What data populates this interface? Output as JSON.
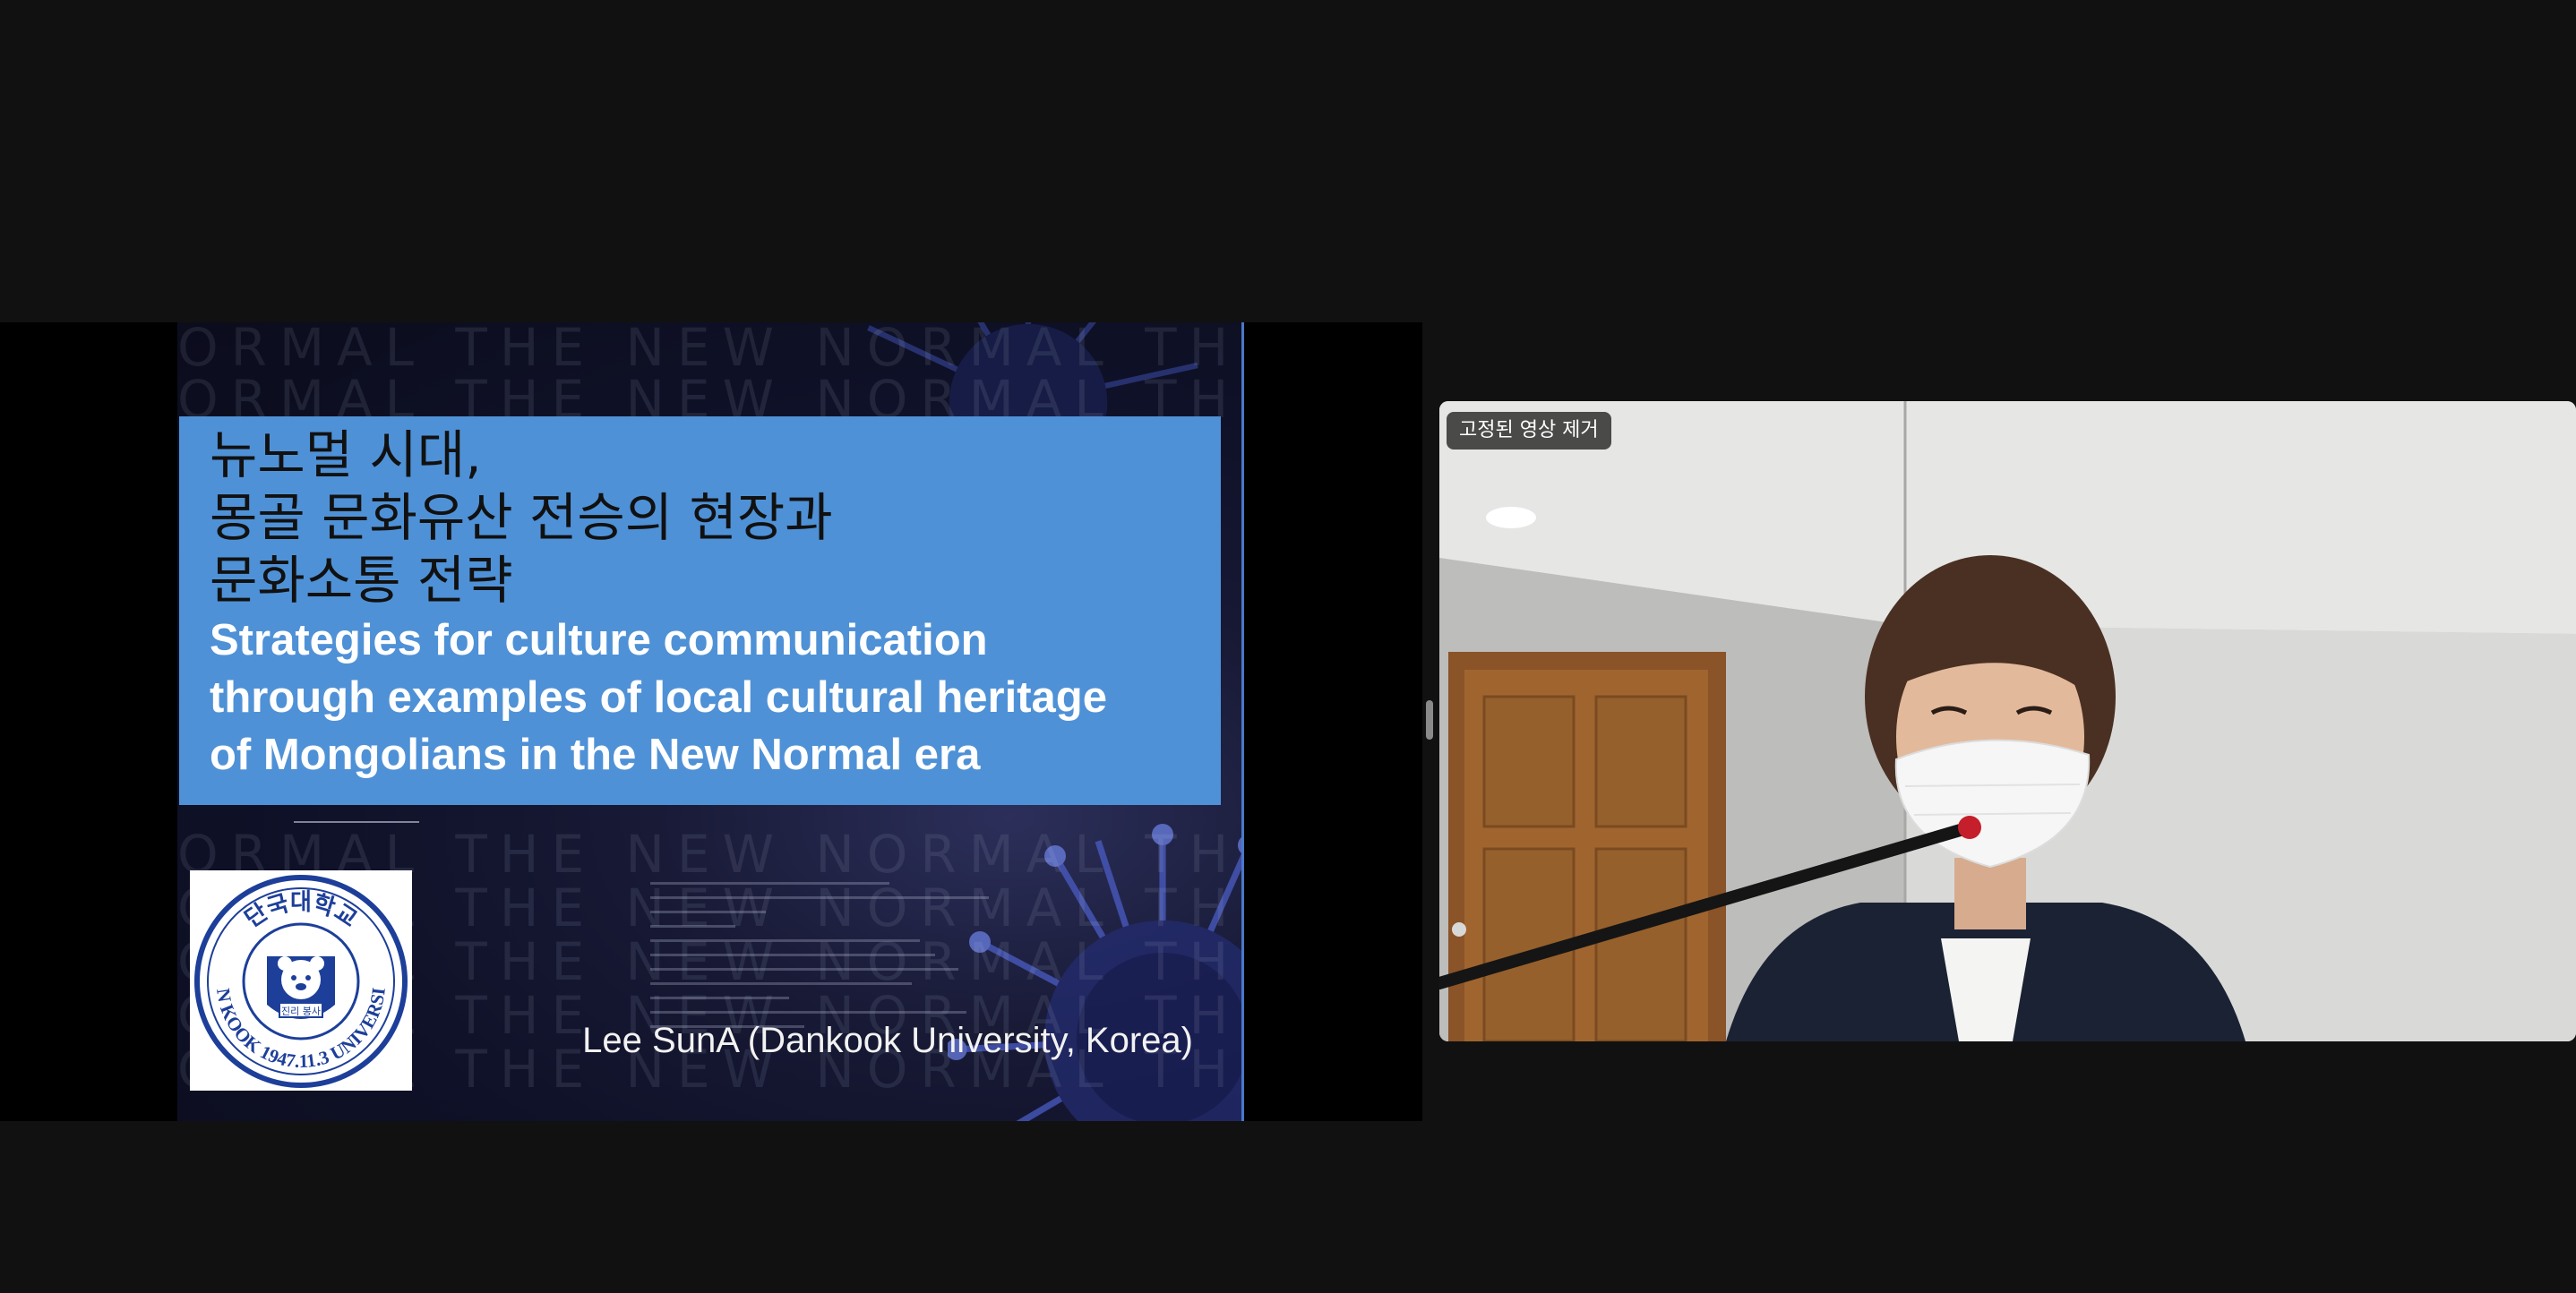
{
  "shared_screen": {
    "slide": {
      "title_ko": [
        "뉴노멀 시대,",
        "몽골 문화유산 전승의 현장과",
        "문화소통 전략"
      ],
      "title_en": [
        "Strategies for culture communication",
        "through examples of local cultural heritage",
        "of Mongolians in the New Normal era"
      ],
      "background_text": "ORMAL THE NEW NORMAL THE NEW NORMAL THE NE",
      "logo": {
        "text_ko": "단국대학교",
        "text_en": "DAN KOOK 1947.11.3 UNIVERSITY",
        "book_text": "진리 봉사"
      },
      "presenter": "Lee SunA (Dankook University, Korea)"
    }
  },
  "video": {
    "pin_badge": "고정된 영상 제거"
  }
}
